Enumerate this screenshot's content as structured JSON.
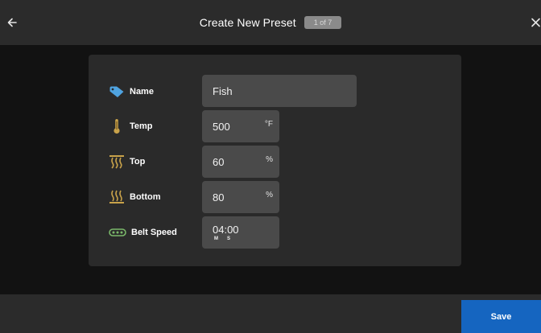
{
  "header": {
    "title": "Create New Preset",
    "step": "1 of 7",
    "back_icon": "arrow-left-icon",
    "close_icon": "close-icon"
  },
  "form": {
    "name": {
      "label": "Name",
      "value": "Fish",
      "icon": "tag-icon"
    },
    "temp": {
      "label": "Temp",
      "value": "500",
      "unit": "°F",
      "icon": "thermometer-icon"
    },
    "top": {
      "label": "Top",
      "value": "60",
      "unit": "%",
      "icon": "top-heat-icon"
    },
    "bottom": {
      "label": "Bottom",
      "value": "80",
      "unit": "%",
      "icon": "bottom-heat-icon"
    },
    "belt_speed": {
      "label": "Belt Speed",
      "value": "04:00",
      "minutes_unit": "M",
      "seconds_unit": "S",
      "icon": "conveyor-belt-icon"
    }
  },
  "footer": {
    "save_label": "Save"
  },
  "colors": {
    "accent": "#1565c0",
    "tag_icon": "#4fa3e0",
    "heat_icon": "#c8a24a",
    "belt_icon": "#7ab86a"
  }
}
